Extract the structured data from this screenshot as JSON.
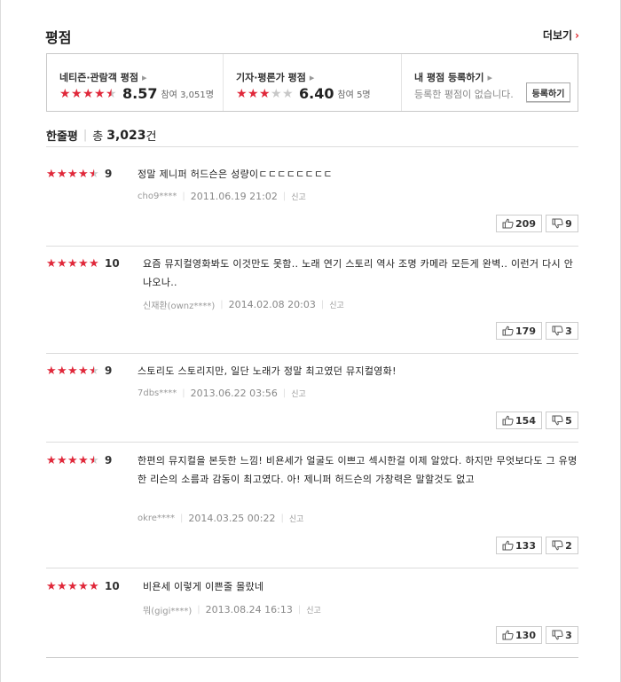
{
  "header": {
    "title": "평점",
    "more_label": "더보기",
    "more_arrow": "›"
  },
  "summary": {
    "netizen": {
      "label": "네티즌·관람객 평점",
      "score": "8.57",
      "participants": "참여 3,051명",
      "stars": [
        1,
        1,
        1,
        1,
        0.5
      ]
    },
    "critic": {
      "label": "기자·평론가 평점",
      "score": "6.40",
      "participants": "참여 5명",
      "stars": [
        1,
        1,
        1,
        0,
        0
      ]
    },
    "mine": {
      "label": "내 평점 등록하기",
      "empty_text": "등록한 평점이 없습니다.",
      "register_label": "등록하기"
    }
  },
  "comment_count": {
    "label": "한줄평",
    "prefix": "총",
    "number": "3,023",
    "suffix": "건"
  },
  "reviews": [
    {
      "score": "9",
      "stars": [
        1,
        1,
        1,
        1,
        0.5
      ],
      "text": "정말 제니퍼 허드슨은 성량이ㄷㄷㄷㄷㄷㄷㄷㄷ",
      "author": "cho9****",
      "date": "2011.06.19 21:02",
      "report": "신고",
      "up": "209",
      "down": "9"
    },
    {
      "score": "10",
      "stars": [
        1,
        1,
        1,
        1,
        1
      ],
      "text": "요즘 뮤지컬영화봐도 이것만도 못함.. 노래 연기 스토리 역사 조명 카메라 모든게 완벽.. 이런거 다시 안나오나..",
      "author": "신재환(ownz****)",
      "date": "2014.02.08 20:03",
      "report": "신고",
      "up": "179",
      "down": "3"
    },
    {
      "score": "9",
      "stars": [
        1,
        1,
        1,
        1,
        0.5
      ],
      "text": "스토리도 스토리지만, 일단 노래가 정말 최고였던 뮤지컬영화!",
      "author": "7dbs****",
      "date": "2013.06.22 03:56",
      "report": "신고",
      "up": "154",
      "down": "5"
    },
    {
      "score": "9",
      "stars": [
        1,
        1,
        1,
        1,
        0.5
      ],
      "text": "한편의 뮤지컬을 본듯한 느낌! 비욘세가 얼굴도 이쁘고 섹시한걸 이제 알았다. 하지만 무엇보다도 그 유명한 리슨의 소름과 감동이 최고였다. 아! 제니퍼 허드슨의 가창력은 말할것도 없고",
      "author": "okre****",
      "date": "2014.03.25 00:22",
      "report": "신고",
      "up": "133",
      "down": "2"
    },
    {
      "score": "10",
      "stars": [
        1,
        1,
        1,
        1,
        1
      ],
      "text": "비욘세 이렇게 이쁜줄 몰랐네",
      "author": "뭐(gigi****)",
      "date": "2013.08.24 16:13",
      "report": "신고",
      "up": "130",
      "down": "3"
    }
  ]
}
